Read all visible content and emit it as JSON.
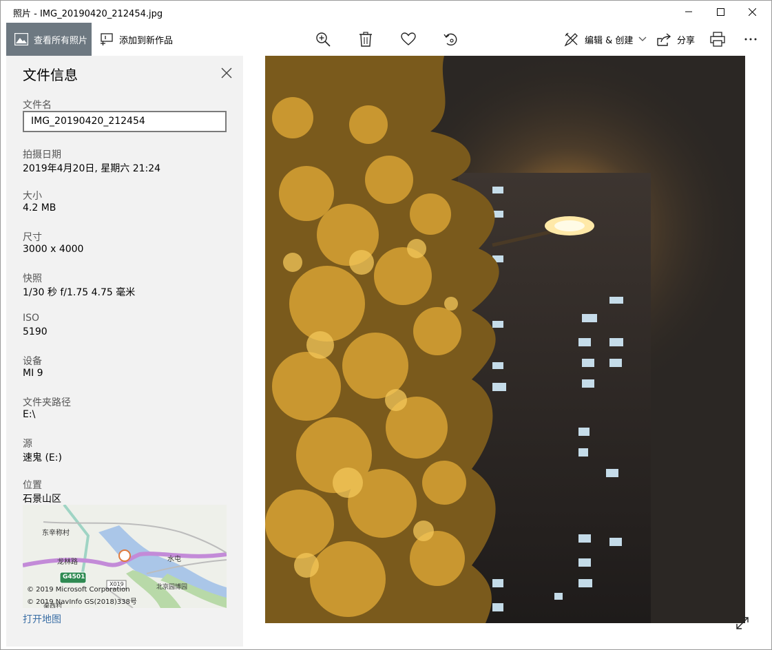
{
  "window": {
    "title": "照片 - IMG_20190420_212454.jpg"
  },
  "toolbar": {
    "view_all_label": "查看所有照片",
    "add_to_label": "添加到新作品",
    "edit_create_label": "编辑 & 创建",
    "share_label": "分享"
  },
  "info": {
    "title": "文件信息",
    "filename_label": "文件名",
    "filename_value": "IMG_20190420_212454",
    "date_label": "拍摄日期",
    "date_value": "2019年4月20日, 星期六 21:24",
    "size_label": "大小",
    "size_value": "4.2 MB",
    "dimensions_label": "尺寸",
    "dimensions_value": "3000 x 4000",
    "shot_label": "快照",
    "shot_value": "1/30 秒 f/1.75 4.75 毫米",
    "iso_label": "ISO",
    "iso_value": "5190",
    "device_label": "设备",
    "device_value": "MI 9",
    "folder_label": "文件夹路径",
    "folder_value": "E:\\",
    "source_label": "源",
    "source_value": "速鬼 (E:)",
    "location_label": "位置",
    "location_value": "石景山区",
    "open_map_label": "打开地图"
  },
  "map": {
    "label_dongxin": "东辛称村",
    "label_longlin": "龙林路",
    "label_shuitun": "水屯",
    "label_g4501": "G4501",
    "label_x019": "X019",
    "label_beijing": "北京园博园",
    "label_cun": "渠西村",
    "credit_1": "© 2019 Microsoft Corporation",
    "credit_2": "© 2019 NavInfo GS(2018)338号"
  },
  "colors": {
    "accent_button": "#6d7881",
    "panel_bg": "#f2f2f2",
    "link": "#3a6ea5"
  }
}
